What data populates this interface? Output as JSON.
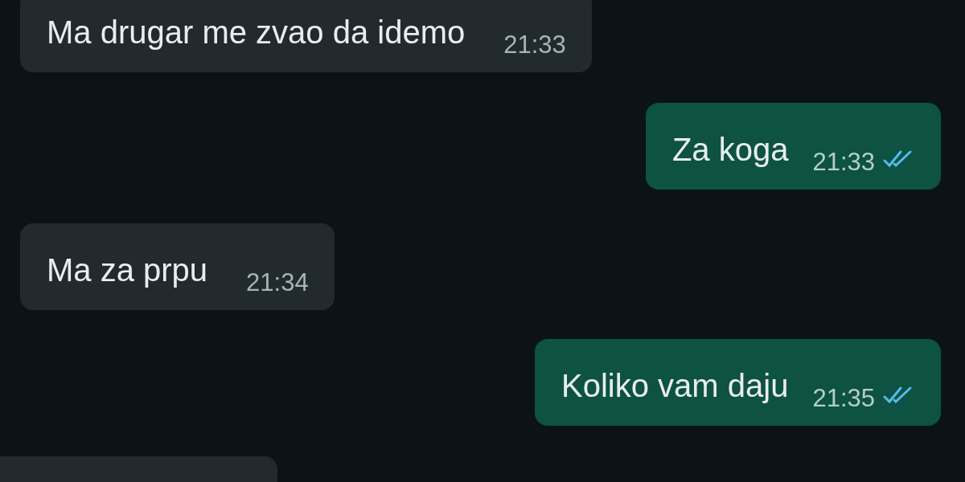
{
  "messages": [
    {
      "kind": "incoming",
      "text": "Ma drugar me zvao da idemo",
      "time": "21:33"
    },
    {
      "kind": "outgoing",
      "text": "Za koga",
      "time": "21:33",
      "read": true
    },
    {
      "kind": "incoming",
      "text": "Ma za prpu",
      "time": "21:34"
    },
    {
      "kind": "outgoing",
      "text": "Koliko vam daju",
      "time": "21:35",
      "read": true
    },
    {
      "kind": "incoming"
    }
  ]
}
